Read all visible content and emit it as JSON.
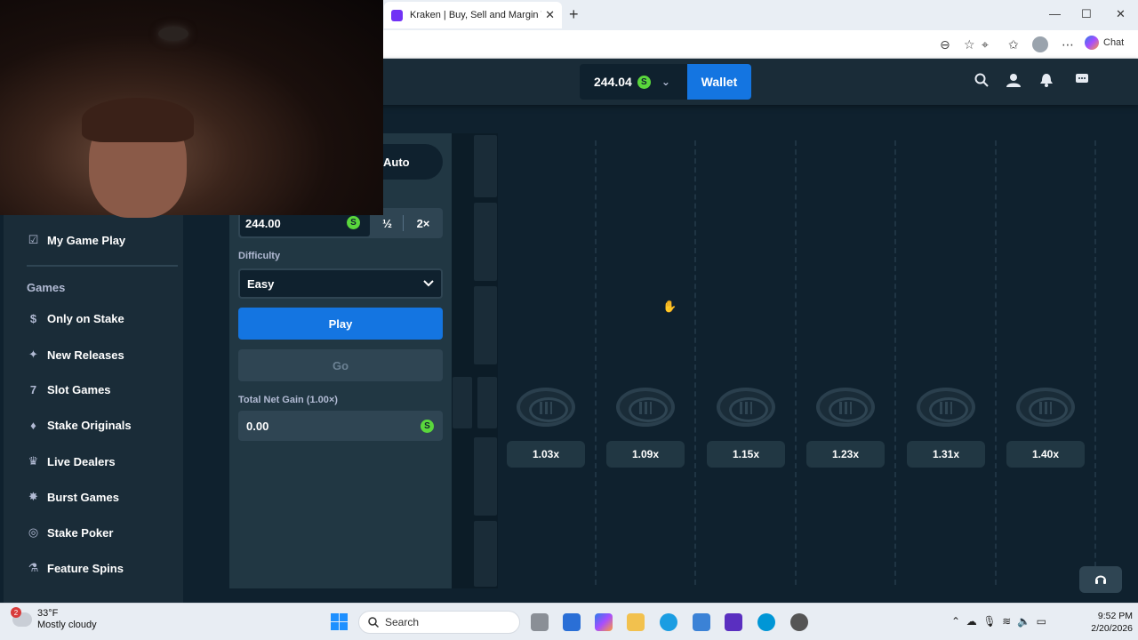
{
  "browser": {
    "tab_title": "Kraken | Buy, Sell and Margin Trad",
    "tab_close": "✕",
    "new_tab": "+",
    "window_controls": [
      "—",
      "☐",
      "✕"
    ],
    "chat_label": "Chat"
  },
  "header": {
    "balance": "244.04",
    "currency_symbol": "S",
    "wallet_label": "Wallet"
  },
  "sidebar": {
    "top_item": "My Game Play",
    "games_heading": "Games",
    "items": [
      {
        "label": "Only on Stake",
        "icon": "stake-icon"
      },
      {
        "label": "New Releases",
        "icon": "sparkle-icon"
      },
      {
        "label": "Slot Games",
        "icon": "slot-icon"
      },
      {
        "label": "Stake Originals",
        "icon": "flame-icon"
      },
      {
        "label": "Live Dealers",
        "icon": "dealer-icon"
      },
      {
        "label": "Burst Games",
        "icon": "burst-icon"
      },
      {
        "label": "Stake Poker",
        "icon": "poker-chip-icon"
      },
      {
        "label": "Feature Spins",
        "icon": "flask-icon"
      }
    ]
  },
  "panel": {
    "mode_label": "Auto",
    "bet_amount": "244.00",
    "half_label": "½",
    "double_label": "2×",
    "difficulty_label": "Difficulty",
    "difficulty_value": "Easy",
    "play_label": "Play",
    "go_label": "Go",
    "net_gain_label": "Total Net Gain (1.00×)",
    "net_gain_value": "0.00"
  },
  "game": {
    "multipliers": [
      "1.03x",
      "1.09x",
      "1.15x",
      "1.23x",
      "1.31x",
      "1.40x"
    ]
  },
  "taskbar": {
    "weather_temp": "33°F",
    "weather_desc": "Mostly cloudy",
    "weather_badge": "2",
    "search_label": "Search",
    "time": "9:52 PM",
    "date": "2/20/2026"
  }
}
